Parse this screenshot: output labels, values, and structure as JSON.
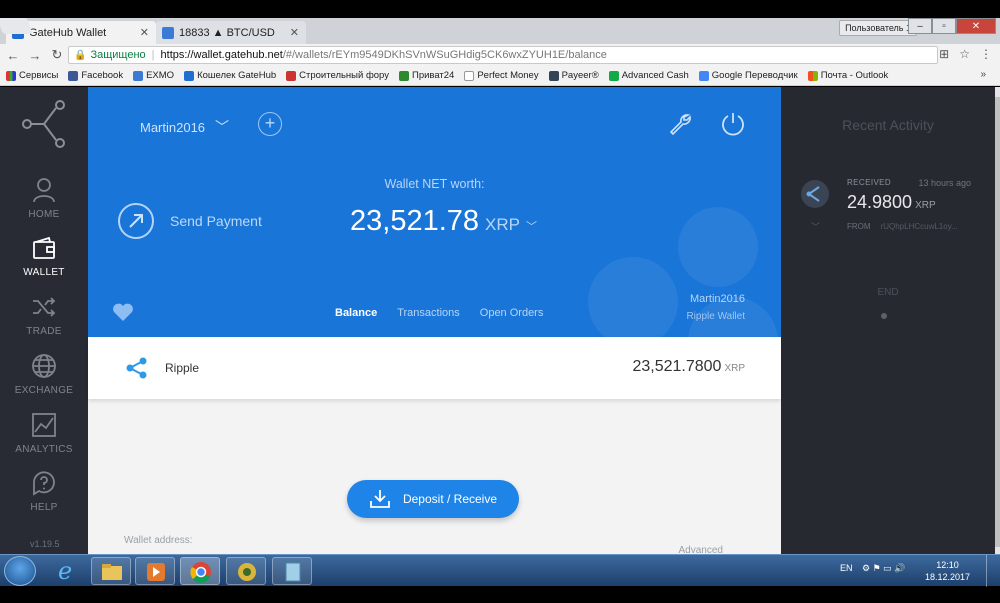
{
  "browser": {
    "tabs": [
      {
        "title": "GateHub Wallet"
      },
      {
        "title": "18833 ▲ BTC/USD"
      }
    ],
    "profile_label": "Пользователь 1",
    "secure_label": "Защищено",
    "url_host": "https://wallet.gatehub.net",
    "url_path": "/#/wallets/rEYm9549DKhSVnWSuGHdig5CK6wxZYUH1E/balance",
    "bookmarks": [
      "Сервисы",
      "Facebook",
      "EXMO",
      "Кошелек GateHub",
      "Строительный фору",
      "Приват24",
      "Perfect Money",
      "Payeer®",
      "Advanced Cash",
      "Google Переводчик",
      "Почта - Outlook"
    ],
    "bookmarks_more": "»"
  },
  "sidebar": {
    "items": [
      {
        "label": "HOME",
        "icon": "user-icon"
      },
      {
        "label": "WALLET",
        "icon": "wallet-icon",
        "active": true
      },
      {
        "label": "TRADE",
        "icon": "shuffle-icon"
      },
      {
        "label": "EXCHANGE",
        "icon": "globe-icon"
      },
      {
        "label": "ANALYTICS",
        "icon": "chart-icon"
      },
      {
        "label": "HELP",
        "icon": "help-icon"
      }
    ],
    "version": "v1.19.5"
  },
  "wallet": {
    "account_name": "Martin2016",
    "send_payment": "Send Payment",
    "networth_label": "Wallet NET worth:",
    "networth_value": "23,521.78",
    "networth_currency": "XRP",
    "tabs": [
      "Balance",
      "Transactions",
      "Open Orders"
    ],
    "active_tab": "Balance",
    "wallet_name": "Martin2016",
    "wallet_type": "Ripple Wallet",
    "balances": [
      {
        "name": "Ripple",
        "amount": "23,521.7800",
        "currency": "XRP"
      }
    ],
    "deposit_label": "Deposit / Receive",
    "wallet_address_label": "Wallet address:",
    "advanced_label": "Advanced"
  },
  "activity": {
    "title": "Recent Activity",
    "items": [
      {
        "status": "RECEIVED",
        "time": "13 hours ago",
        "amount": "24.9800",
        "currency": "XRP",
        "from_label": "FROM",
        "from_addr": "rUQhpLHCcuwL1oy..."
      }
    ],
    "end_label": "END"
  },
  "taskbar": {
    "lang": "EN",
    "time": "12:10",
    "date": "18.12.2017"
  },
  "colors": {
    "hero_blue": "#1975d8",
    "sidebar": "#282b33",
    "deposit_button": "#1f84e8"
  }
}
